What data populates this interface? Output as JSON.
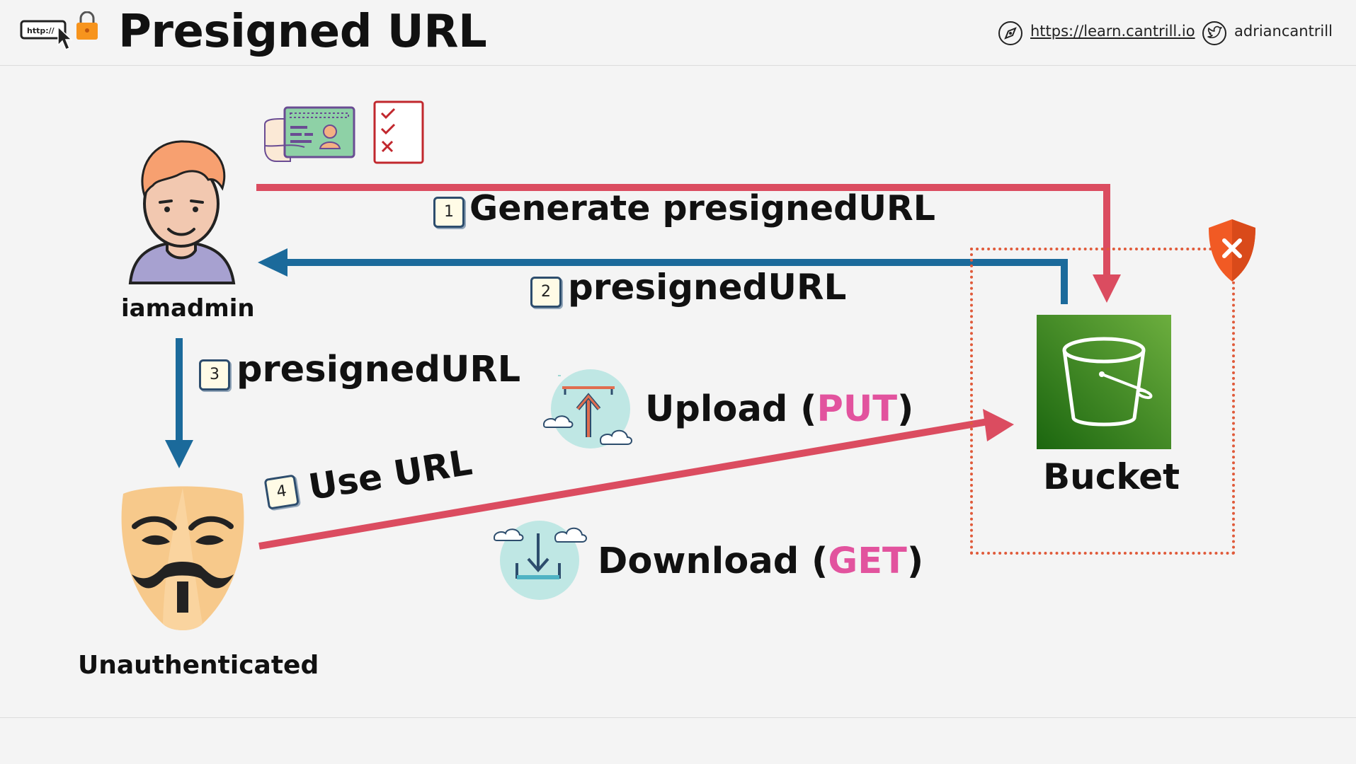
{
  "header": {
    "title": "Presigned URL",
    "url_link": "https://learn.cantrill.io",
    "twitter_handle": "adriancantrill",
    "logo_text": "http://"
  },
  "actors": {
    "admin": "iamadmin",
    "anon": "Unauthenticated",
    "bucket": "Bucket"
  },
  "steps": [
    {
      "num": "1",
      "text": "Generate presignedURL"
    },
    {
      "num": "2",
      "text": "presignedURL"
    },
    {
      "num": "3",
      "text": "presignedURL"
    },
    {
      "num": "4",
      "text": "Use URL"
    }
  ],
  "operations": {
    "upload": {
      "label": "Upload",
      "method": "PUT"
    },
    "download": {
      "label": "Download",
      "method": "GET"
    }
  },
  "colors": {
    "red_arrow": "#db4c60",
    "blue_arrow": "#1b6a9b",
    "method": "#e2539e",
    "bucket_green": "#3d8b2b",
    "shield_orange": "#f15a24",
    "dotted_border": "#e05a3a"
  },
  "icons": [
    "http-lock-logo-icon",
    "compass-icon",
    "twitter-icon",
    "admin-avatar-icon",
    "id-card-icon",
    "checklist-icon",
    "anonymous-mask-icon",
    "upload-cloud-icon",
    "download-cloud-icon",
    "s3-bucket-icon",
    "shield-deny-icon"
  ]
}
